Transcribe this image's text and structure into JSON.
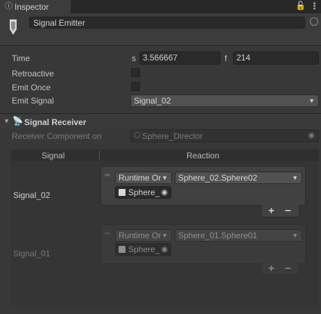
{
  "tab": {
    "title": "Inspector",
    "icon": "info-icon"
  },
  "header": {
    "object_name": "Signal Emitter"
  },
  "fields": {
    "time_label": "Time",
    "time_s_prefix": "s",
    "time_s_value": "3.566667",
    "time_f_prefix": "f",
    "time_f_value": "214",
    "retroactive_label": "Retroactive",
    "retroactive_checked": false,
    "emit_once_label": "Emit Once",
    "emit_once_checked": false,
    "emit_signal_label": "Emit Signal",
    "emit_signal_value": "Signal_02"
  },
  "receiver": {
    "section_title": "Signal Receiver",
    "component_label": "Receiver Component on",
    "component_value": "Sphere_Director",
    "col_signal": "Signal",
    "col_reaction": "Reaction",
    "rows": [
      {
        "signal": "Signal_02",
        "runtime": "Runtime Or",
        "function": "Sphere_02.Sphere02",
        "object": "Sphere_",
        "plus": "+",
        "minus": "−"
      },
      {
        "signal": "Signal_01",
        "runtime": "Runtime Or",
        "function": "Sphere_01.Sphere01",
        "object": "Sphere_",
        "plus": "+",
        "minus": "−"
      }
    ]
  }
}
